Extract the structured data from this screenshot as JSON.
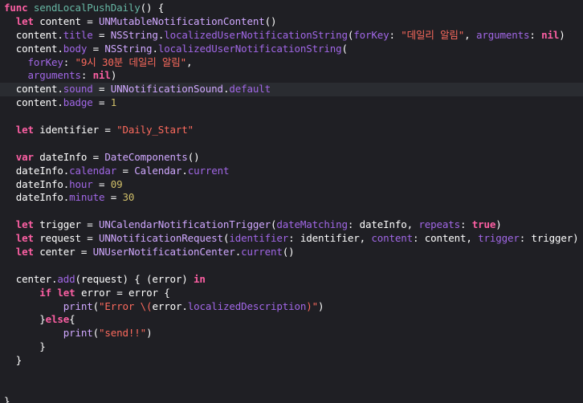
{
  "editor": {
    "language": "swift",
    "theme_colors": {
      "background": "#1f1f24",
      "current_line": "#2a2c31",
      "keyword": "#fc5fa3",
      "type": "#d0a8ff",
      "property": "#a167e6",
      "string": "#fc6a5d",
      "number": "#d0bf69",
      "plain": "#ffffff"
    },
    "current_line_index": 6,
    "lines": [
      [
        [
          "kw",
          "func"
        ],
        [
          "pln",
          " "
        ],
        [
          "fn",
          "sendLocalPushDaily"
        ],
        [
          "pln",
          "() {"
        ]
      ],
      [
        [
          "pln",
          "  "
        ],
        [
          "kw",
          "let"
        ],
        [
          "pln",
          " content = "
        ],
        [
          "typ",
          "UNMutableNotificationContent"
        ],
        [
          "pln",
          "()"
        ]
      ],
      [
        [
          "pln",
          "  content."
        ],
        [
          "prop",
          "title"
        ],
        [
          "pln",
          " = "
        ],
        [
          "typ",
          "NSString"
        ],
        [
          "pln",
          "."
        ],
        [
          "prop",
          "localizedUserNotificationString"
        ],
        [
          "pln",
          "("
        ],
        [
          "lbl",
          "forKey"
        ],
        [
          "pln",
          ": "
        ],
        [
          "str",
          "\"데일리 알림\""
        ],
        [
          "pln",
          ", "
        ],
        [
          "lbl",
          "arguments"
        ],
        [
          "pln",
          ": "
        ],
        [
          "kw",
          "nil"
        ],
        [
          "pln",
          ")"
        ]
      ],
      [
        [
          "pln",
          "  content."
        ],
        [
          "prop",
          "body"
        ],
        [
          "pln",
          " = "
        ],
        [
          "typ",
          "NSString"
        ],
        [
          "pln",
          "."
        ],
        [
          "prop",
          "localizedUserNotificationString"
        ],
        [
          "pln",
          "("
        ]
      ],
      [
        [
          "pln",
          "    "
        ],
        [
          "lbl",
          "forKey"
        ],
        [
          "pln",
          ": "
        ],
        [
          "str",
          "\"9시 30분 데일리 알림\""
        ],
        [
          "pln",
          ","
        ]
      ],
      [
        [
          "pln",
          "    "
        ],
        [
          "lbl",
          "arguments"
        ],
        [
          "pln",
          ": "
        ],
        [
          "kw",
          "nil"
        ],
        [
          "pln",
          ")"
        ]
      ],
      [
        [
          "pln",
          "  content."
        ],
        [
          "prop",
          "sound"
        ],
        [
          "pln",
          " = "
        ],
        [
          "typ",
          "UNNotificationSound"
        ],
        [
          "pln",
          "."
        ],
        [
          "prop",
          "default"
        ]
      ],
      [
        [
          "pln",
          "  content."
        ],
        [
          "prop",
          "badge"
        ],
        [
          "pln",
          " = "
        ],
        [
          "num",
          "1"
        ]
      ],
      [
        [
          "pln",
          ""
        ]
      ],
      [
        [
          "pln",
          "  "
        ],
        [
          "kw",
          "let"
        ],
        [
          "pln",
          " identifier = "
        ],
        [
          "str",
          "\"Daily_Start\""
        ]
      ],
      [
        [
          "pln",
          ""
        ]
      ],
      [
        [
          "pln",
          "  "
        ],
        [
          "kw",
          "var"
        ],
        [
          "pln",
          " dateInfo = "
        ],
        [
          "typ",
          "DateComponents"
        ],
        [
          "pln",
          "()"
        ]
      ],
      [
        [
          "pln",
          "  dateInfo."
        ],
        [
          "prop",
          "calendar"
        ],
        [
          "pln",
          " = "
        ],
        [
          "typ",
          "Calendar"
        ],
        [
          "pln",
          "."
        ],
        [
          "prop",
          "current"
        ]
      ],
      [
        [
          "pln",
          "  dateInfo."
        ],
        [
          "prop",
          "hour"
        ],
        [
          "pln",
          " = "
        ],
        [
          "num",
          "09"
        ]
      ],
      [
        [
          "pln",
          "  dateInfo."
        ],
        [
          "prop",
          "minute"
        ],
        [
          "pln",
          " = "
        ],
        [
          "num",
          "30"
        ]
      ],
      [
        [
          "pln",
          ""
        ]
      ],
      [
        [
          "pln",
          "  "
        ],
        [
          "kw",
          "let"
        ],
        [
          "pln",
          " trigger = "
        ],
        [
          "typ",
          "UNCalendarNotificationTrigger"
        ],
        [
          "pln",
          "("
        ],
        [
          "lbl",
          "dateMatching"
        ],
        [
          "pln",
          ": dateInfo, "
        ],
        [
          "lbl",
          "repeats"
        ],
        [
          "pln",
          ": "
        ],
        [
          "kw",
          "true"
        ],
        [
          "pln",
          ")"
        ]
      ],
      [
        [
          "pln",
          "  "
        ],
        [
          "kw",
          "let"
        ],
        [
          "pln",
          " request = "
        ],
        [
          "typ",
          "UNNotificationRequest"
        ],
        [
          "pln",
          "("
        ],
        [
          "lbl",
          "identifier"
        ],
        [
          "pln",
          ": identifier, "
        ],
        [
          "lbl",
          "content"
        ],
        [
          "pln",
          ": content, "
        ],
        [
          "lbl",
          "trigger"
        ],
        [
          "pln",
          ": trigger)"
        ]
      ],
      [
        [
          "pln",
          "  "
        ],
        [
          "kw",
          "let"
        ],
        [
          "pln",
          " center = "
        ],
        [
          "typ",
          "UNUserNotificationCenter"
        ],
        [
          "pln",
          "."
        ],
        [
          "prop",
          "current"
        ],
        [
          "pln",
          "()"
        ]
      ],
      [
        [
          "pln",
          ""
        ]
      ],
      [
        [
          "pln",
          "  center."
        ],
        [
          "prop",
          "add"
        ],
        [
          "pln",
          "(request) { (error) "
        ],
        [
          "kw",
          "in"
        ]
      ],
      [
        [
          "pln",
          "      "
        ],
        [
          "kw",
          "if"
        ],
        [
          "pln",
          " "
        ],
        [
          "kw",
          "let"
        ],
        [
          "pln",
          " error = error {"
        ]
      ],
      [
        [
          "pln",
          "          "
        ],
        [
          "typ",
          "print"
        ],
        [
          "pln",
          "("
        ],
        [
          "str",
          "\"Error \\("
        ],
        [
          "pln",
          "error."
        ],
        [
          "prop",
          "localizedDescription"
        ],
        [
          "str",
          ")\""
        ],
        [
          "pln",
          ")"
        ]
      ],
      [
        [
          "pln",
          "      }"
        ],
        [
          "kw",
          "else"
        ],
        [
          "pln",
          "{"
        ]
      ],
      [
        [
          "pln",
          "          "
        ],
        [
          "typ",
          "print"
        ],
        [
          "pln",
          "("
        ],
        [
          "str",
          "\"send!!\""
        ],
        [
          "pln",
          ")"
        ]
      ],
      [
        [
          "pln",
          "      }"
        ]
      ],
      [
        [
          "pln",
          "  }"
        ]
      ],
      [
        [
          "pln",
          ""
        ]
      ],
      [
        [
          "pln",
          ""
        ]
      ],
      [
        [
          "pln",
          "}"
        ]
      ]
    ]
  }
}
